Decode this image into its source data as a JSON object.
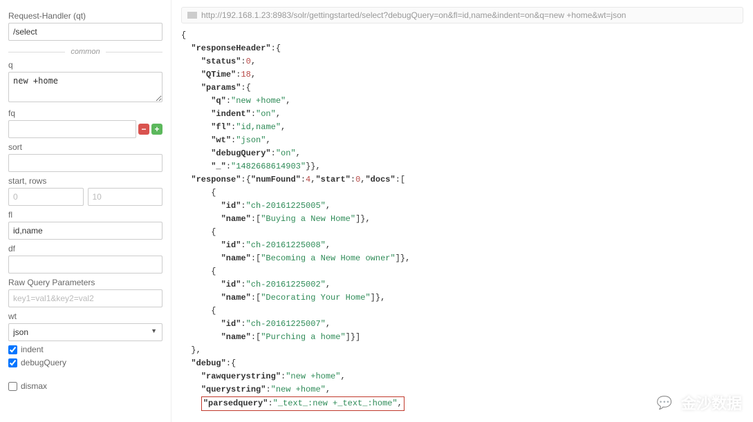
{
  "sidebar": {
    "qt_label": "Request-Handler (qt)",
    "qt_value": "/select",
    "divider_common": "common",
    "q_label": "q",
    "q_value": "new +home",
    "fq_label": "fq",
    "fq_value": "",
    "sort_label": "sort",
    "sort_value": "",
    "start_rows_label": "start, rows",
    "start_placeholder": "0",
    "rows_placeholder": "10",
    "fl_label": "fl",
    "fl_value": "id,name",
    "df_label": "df",
    "df_value": "",
    "rawquery_label": "Raw Query Parameters",
    "rawquery_placeholder": "key1=val1&key2=val2",
    "wt_label": "wt",
    "wt_value": "json",
    "indent_label": "indent",
    "debugQuery_label": "debugQuery",
    "dismax_label": "dismax"
  },
  "url": "http://192.168.1.23:8983/solr/gettingstarted/select?debugQuery=on&fl=id,name&indent=on&q=new +home&wt=json",
  "response": {
    "responseHeader": {
      "status": 0,
      "QTime": 18,
      "params": {
        "q": "new +home",
        "indent": "on",
        "fl": "id,name",
        "wt": "json",
        "debugQuery": "on",
        "_": "1482668614903"
      }
    },
    "response_block": {
      "numFound": 4,
      "start": 0,
      "docs": [
        {
          "id": "ch-20161225005",
          "name": "Buying a New Home"
        },
        {
          "id": "ch-20161225008",
          "name": "Becoming a New Home owner"
        },
        {
          "id": "ch-20161225002",
          "name": "Decorating Your Home"
        },
        {
          "id": "ch-20161225007",
          "name": "Purching a home"
        }
      ]
    },
    "debug": {
      "rawquerystring": "new +home",
      "querystring": "new +home",
      "parsedquery": "_text_:new +_text_:home"
    }
  },
  "watermark": "金沙数据"
}
